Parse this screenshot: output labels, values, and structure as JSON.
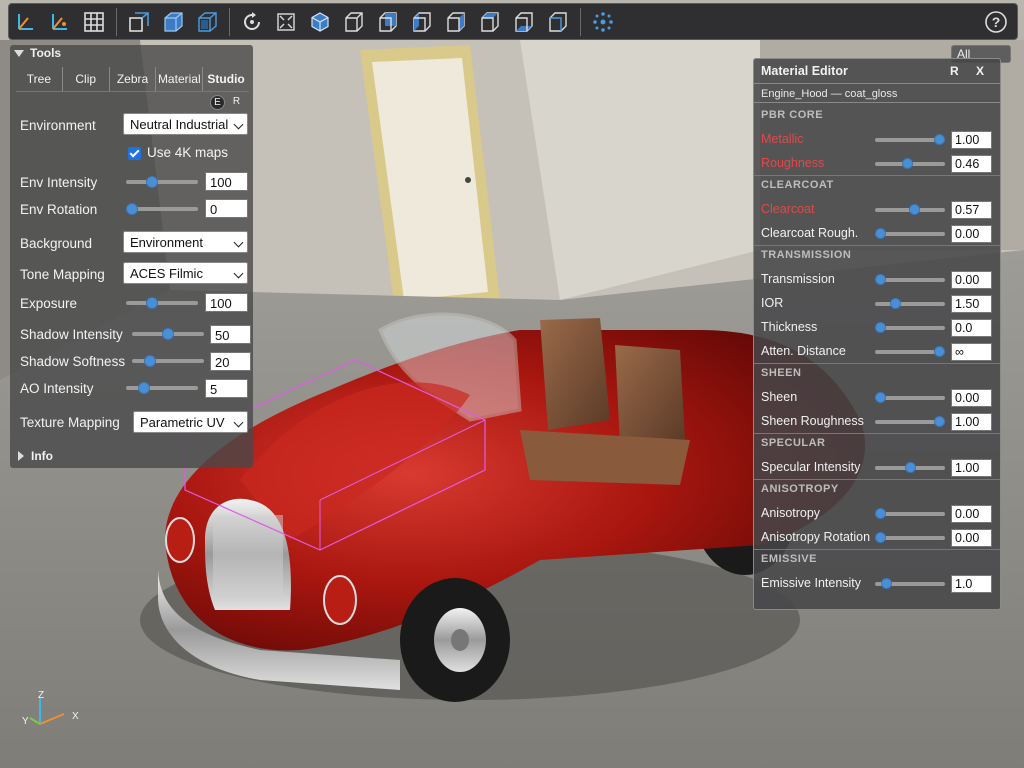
{
  "toolbar": {
    "buttons": [
      "axes-select-icon",
      "axes-measure-icon",
      "grid-icon",
      "box-clip-icon",
      "cube-shaded-icon",
      "cube-wire-icon",
      "rotate-icon",
      "fit-view-icon",
      "view-iso-icon",
      "view-front-icon",
      "view-back-icon",
      "view-left-icon",
      "view-right-icon",
      "view-top-icon",
      "view-bottom-icon",
      "explode-icon"
    ],
    "help": "?"
  },
  "tools_panel": {
    "title": "Tools",
    "tabs": [
      "Tree",
      "Clip",
      "Zebra",
      "Material",
      "Studio"
    ],
    "active_tab": "Studio",
    "er": [
      "E",
      "R"
    ],
    "environment": {
      "label": "Environment",
      "value": "Neutral Industrial"
    },
    "use4k": {
      "label": "Use 4K maps",
      "checked": true
    },
    "env_intensity": {
      "label": "Env Intensity",
      "value": "100",
      "fraction": 0.33
    },
    "env_rotation": {
      "label": "Env Rotation",
      "value": "0",
      "fraction": 0.0
    },
    "background": {
      "label": "Background",
      "value": "Environment"
    },
    "tone_mapping": {
      "label": "Tone Mapping",
      "value": "ACES Filmic"
    },
    "exposure": {
      "label": "Exposure",
      "value": "100",
      "fraction": 0.33
    },
    "shadow_intensity": {
      "label": "Shadow Intensity",
      "value": "50",
      "fraction": 0.5
    },
    "shadow_softness": {
      "label": "Shadow Softness",
      "value": "20",
      "fraction": 0.2
    },
    "ao_intensity": {
      "label": "AO Intensity",
      "value": "5",
      "fraction": 0.2
    },
    "texture_mapping": {
      "label": "Texture Mapping",
      "value": "Parametric UV"
    },
    "info": "Info"
  },
  "all_dropdown": "All",
  "material_editor": {
    "title": "Material Editor",
    "controls": "R X",
    "subtitle": "Engine_Hood — coat_gloss",
    "sections": [
      {
        "name": "PBR CORE",
        "props": [
          {
            "label": "Metallic",
            "value": "1.00",
            "fraction": 1.0,
            "modified": true
          },
          {
            "label": "Roughness",
            "value": "0.46",
            "fraction": 0.46,
            "modified": true
          }
        ]
      },
      {
        "name": "CLEARCOAT",
        "props": [
          {
            "label": "Clearcoat",
            "value": "0.57",
            "fraction": 0.57,
            "modified": true
          },
          {
            "label": "Clearcoat Rough.",
            "value": "0.00",
            "fraction": 0.0,
            "modified": false
          }
        ]
      },
      {
        "name": "TRANSMISSION",
        "props": [
          {
            "label": "Transmission",
            "value": "0.00",
            "fraction": 0.0,
            "modified": false
          },
          {
            "label": "IOR",
            "value": "1.50",
            "fraction": 0.25,
            "modified": false
          },
          {
            "label": "Thickness",
            "value": "0.0",
            "fraction": 0.0,
            "modified": false
          },
          {
            "label": "Atten. Distance",
            "value": "∞",
            "fraction": 1.0,
            "modified": false
          }
        ]
      },
      {
        "name": "SHEEN",
        "props": [
          {
            "label": "Sheen",
            "value": "0.00",
            "fraction": 0.0,
            "modified": false
          },
          {
            "label": "Sheen Roughness",
            "value": "1.00",
            "fraction": 1.0,
            "modified": false
          }
        ]
      },
      {
        "name": "SPECULAR",
        "props": [
          {
            "label": "Specular Intensity",
            "value": "1.00",
            "fraction": 0.5,
            "modified": false
          }
        ]
      },
      {
        "name": "ANISOTROPY",
        "props": [
          {
            "label": "Anisotropy",
            "value": "0.00",
            "fraction": 0.0,
            "modified": false
          },
          {
            "label": "Anisotropy Rotation",
            "value": "0.00",
            "fraction": 0.0,
            "modified": false
          }
        ]
      },
      {
        "name": "EMISSIVE",
        "props": [
          {
            "label": "Emissive Intensity",
            "value": "1.0",
            "fraction": 0.1,
            "modified": false
          }
        ]
      }
    ]
  },
  "gizmo": {
    "x": "X",
    "y": "Y",
    "z": "Z"
  }
}
